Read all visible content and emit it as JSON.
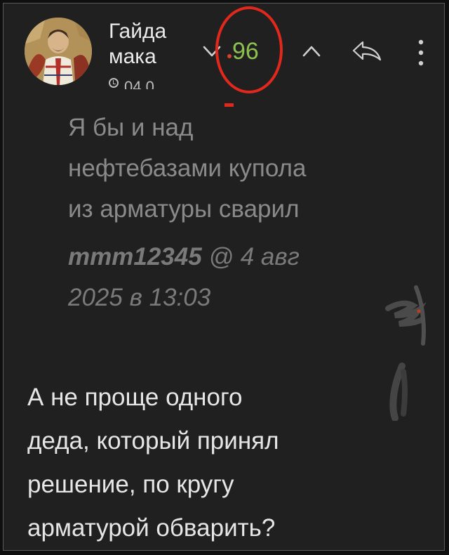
{
  "comment": {
    "author": {
      "name_line1": "Гайда",
      "name_line2": "мака"
    },
    "timestamp": "04.0",
    "rating": "96",
    "icons": {
      "vote_down": "chevron-down-icon",
      "vote_up": "chevron-up-icon",
      "reply": "reply-icon",
      "more": "more-vertical-icon",
      "clock": "clock-icon"
    },
    "colors": {
      "rating": "#8cc04f",
      "annotation": "#e2281d",
      "background": "#202020"
    },
    "quote": {
      "lines": [
        "Я бы и над",
        "нефтебазами купола",
        "из арматуры сварил"
      ],
      "author": "mmm12345",
      "date_prefix": "@ 4 авг",
      "date_line2": "2025 в 13:03"
    },
    "body": {
      "lines": [
        "А не проще одного",
        "деда, который принял",
        "решение, по кругу",
        "арматурой обварить?"
      ]
    }
  }
}
